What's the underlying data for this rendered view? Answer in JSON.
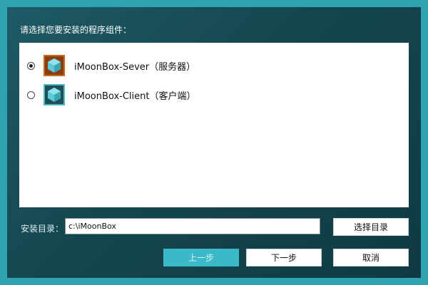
{
  "prompt": "请选择您要安装的程序组件：",
  "components": [
    {
      "label": "iMoonBox-Sever（服务器）",
      "selected": true,
      "icon": "server-cube-icon",
      "color": "#8a3c12"
    },
    {
      "label": "iMoonBox-Client（客户端）",
      "selected": false,
      "icon": "client-cube-icon",
      "color": "#1e4f57"
    }
  ],
  "install_dir": {
    "label": "安装目录：",
    "value": "c:\\iMoonBox"
  },
  "buttons": {
    "browse": "选择目录",
    "prev": "上一步",
    "next": "下一步",
    "cancel": "取消"
  },
  "colors": {
    "border": "#2ea4b2",
    "accent": "#3bb9c8",
    "background": "#15464f"
  }
}
